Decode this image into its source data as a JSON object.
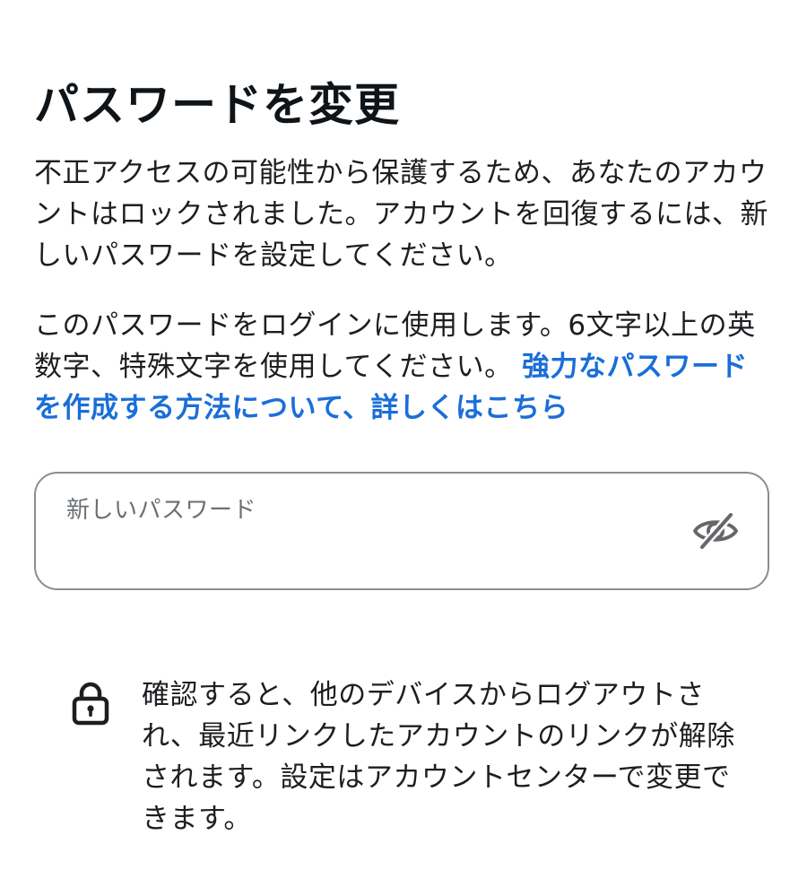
{
  "header": {
    "title": "パスワードを変更"
  },
  "description": {
    "locked_notice": "不正アクセスの可能性から保護するため、あなたのアカウントはロックされました。アカウントを回復するには、新しいパスワードを設定してください。",
    "requirements": "このパスワードをログインに使用します。6文字以上の英数字、特殊文字を使用してください。",
    "learn_more_link": "強力なパスワードを作成する方法について、詳しくはこちら"
  },
  "password_field": {
    "placeholder": "新しいパスワード",
    "value": "",
    "visibility_icon": "eye-slash-icon"
  },
  "footer_notice": {
    "icon": "lock-icon",
    "text": "確認すると、他のデバイスからログアウトされ、最近リンクしたアカウントのリンクが解除されます。設定はアカウントセンターで変更できます。"
  },
  "colors": {
    "link": "#1a6ed8",
    "text": "#1c1e21",
    "border": "#8a8d91",
    "placeholder": "#6b6f75"
  }
}
